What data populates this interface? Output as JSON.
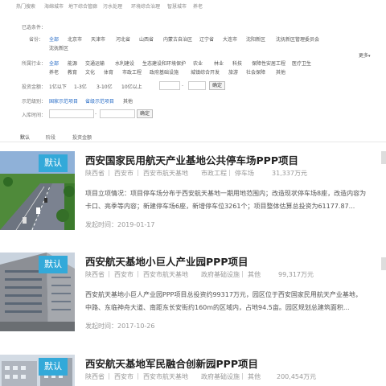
{
  "top_nav": [
    "热门搜索",
    "海绵城市",
    "地下综合管廊",
    "污水处理",
    "环境综合治理",
    "智慧城市",
    "养老"
  ],
  "filter": {
    "selected_label": "已选条件：",
    "province_label": "省份：",
    "provinces_row1": [
      "全部",
      "北京市",
      "天津市",
      "河北省",
      "山西省",
      "内蒙古自治区",
      "辽宁省",
      "大连市",
      "沈阳新区",
      "沈抚新区管理委员会"
    ],
    "provinces_row2": [
      "沈抚新区"
    ],
    "more_label": "更多",
    "industry_label": "所属行业：",
    "industries_row1": [
      "全部",
      "能源",
      "交通运输",
      "水利建设",
      "生态建设和环境保护",
      "农业",
      "林业",
      "科技",
      "保障性安居工程",
      "医疗卫生"
    ],
    "industries_row2": [
      "养老",
      "教育",
      "文化",
      "体育",
      "市政工程",
      "政府基础设施",
      "城镇综合开发",
      "旅游",
      "社会保障",
      "其他"
    ],
    "amount_label": "投资金额：",
    "amounts": [
      "1亿以下",
      "1-3亿",
      "3-10亿",
      "10亿以上"
    ],
    "amount_dash": "-",
    "confirm_label": "确定",
    "demo_label": "示范级别：",
    "demo_levels": [
      "国家示范项目",
      "省级示范项目",
      "其他"
    ],
    "date_label": "入库时间：",
    "date_dash": "-"
  },
  "sort_tabs": [
    "默认",
    "阶段",
    "投资金额"
  ],
  "badge_label": "默认",
  "projects": [
    {
      "title": "西安国家民用航天产业基地公共停车场PPP项目",
      "province": "陕西省",
      "city": "西安市",
      "district": "西安市航天基地",
      "category": "市政工程",
      "subcategory": "停车场",
      "amount": "31,337万元",
      "desc_line1": "项目立项情况：项目停车场分布于西安航天基地一期用地范围内；改造现状停车场8座，改造内容为",
      "desc_line2": "卡口、亮季等内容；新建停车场6座，新增停车位3261个；项目整体估算总投资为61177.87...",
      "date": "发起时间：2019-01-17"
    },
    {
      "title": "西安航天基地小巨人产业园PPP项目",
      "province": "陕西省",
      "city": "西安市",
      "district": "西安市航天基地",
      "category": "政府基础设施",
      "subcategory": "其他",
      "amount": "99,317万元",
      "desc_line1": "西安航天基地小巨人产业园PPP项目总投资约99317万元，园区位于西安国家民用航天产业基地，",
      "desc_line2": "中路、东临神舟大道、南距东长安街约160m的区域内，占地94.5亩。园区规划总建筑面积...",
      "date": "发起时间：2017-10-26"
    },
    {
      "title": "西安航天基地军民融合创新园PPP项目",
      "province": "陕西省",
      "city": "西安市",
      "district": "西安市航天基地",
      "category": "政府基础设施",
      "subcategory": "其他",
      "amount": "200,454万元"
    }
  ]
}
